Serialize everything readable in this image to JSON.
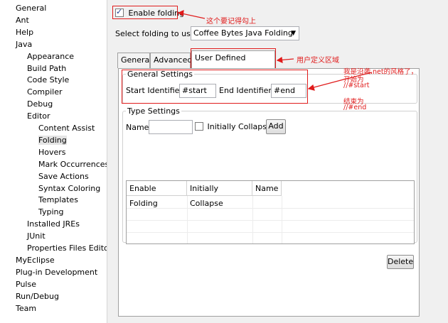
{
  "tree": {
    "items": [
      {
        "label": "General",
        "level": 0
      },
      {
        "label": "Ant",
        "level": 0
      },
      {
        "label": "Help",
        "level": 0
      },
      {
        "label": "Java",
        "level": 0
      },
      {
        "label": "Appearance",
        "level": 1
      },
      {
        "label": "Build Path",
        "level": 1
      },
      {
        "label": "Code Style",
        "level": 1
      },
      {
        "label": "Compiler",
        "level": 1
      },
      {
        "label": "Debug",
        "level": 1
      },
      {
        "label": "Editor",
        "level": 1
      },
      {
        "label": "Content Assist",
        "level": 2
      },
      {
        "label": "Folding",
        "level": 2,
        "selected": true
      },
      {
        "label": "Hovers",
        "level": 2
      },
      {
        "label": "Mark Occurrences",
        "level": 2
      },
      {
        "label": "Save Actions",
        "level": 2
      },
      {
        "label": "Syntax Coloring",
        "level": 2
      },
      {
        "label": "Templates",
        "level": 2
      },
      {
        "label": "Typing",
        "level": 2
      },
      {
        "label": "Installed JREs",
        "level": 1
      },
      {
        "label": "JUnit",
        "level": 1
      },
      {
        "label": "Properties Files Edito",
        "level": 1
      },
      {
        "label": "MyEclipse",
        "level": 0
      },
      {
        "label": "Plug-in Development",
        "level": 0
      },
      {
        "label": "Pulse",
        "level": 0
      },
      {
        "label": "Run/Debug",
        "level": 0
      },
      {
        "label": "Team",
        "level": 0
      }
    ]
  },
  "folding": {
    "enable_label": "Enable folding",
    "enabled": true,
    "select_label": "Select folding to use:",
    "select_value": "Coffee Bytes Java Folding"
  },
  "tabs": [
    "General",
    "Advanced",
    "User Defined Regions"
  ],
  "general_settings": {
    "title": "General Settings",
    "start_label": "Start Identifier:",
    "start_value": "#start",
    "end_label": "End Identifier:",
    "end_value": "#end"
  },
  "type_settings": {
    "title": "Type Settings",
    "name_label": "Name",
    "name_value": "",
    "collapse_label": "Initially Collapse",
    "add_label": "Add",
    "columns": [
      "Enable Folding",
      "Initially Collapse",
      "Name"
    ],
    "delete_label": "Delete"
  },
  "annotations": {
    "enable_note": "这个要记得勾上",
    "tab_note": "用户定义区域",
    "right_line1": "我是沿袭.net的风格了，",
    "right_line2": "开始为",
    "right_line3": "//#start",
    "right_line4": "结束为",
    "right_line5": "//#end"
  },
  "colors": {
    "annotation": "#e01b1b",
    "panel": "#f0f0f0"
  }
}
